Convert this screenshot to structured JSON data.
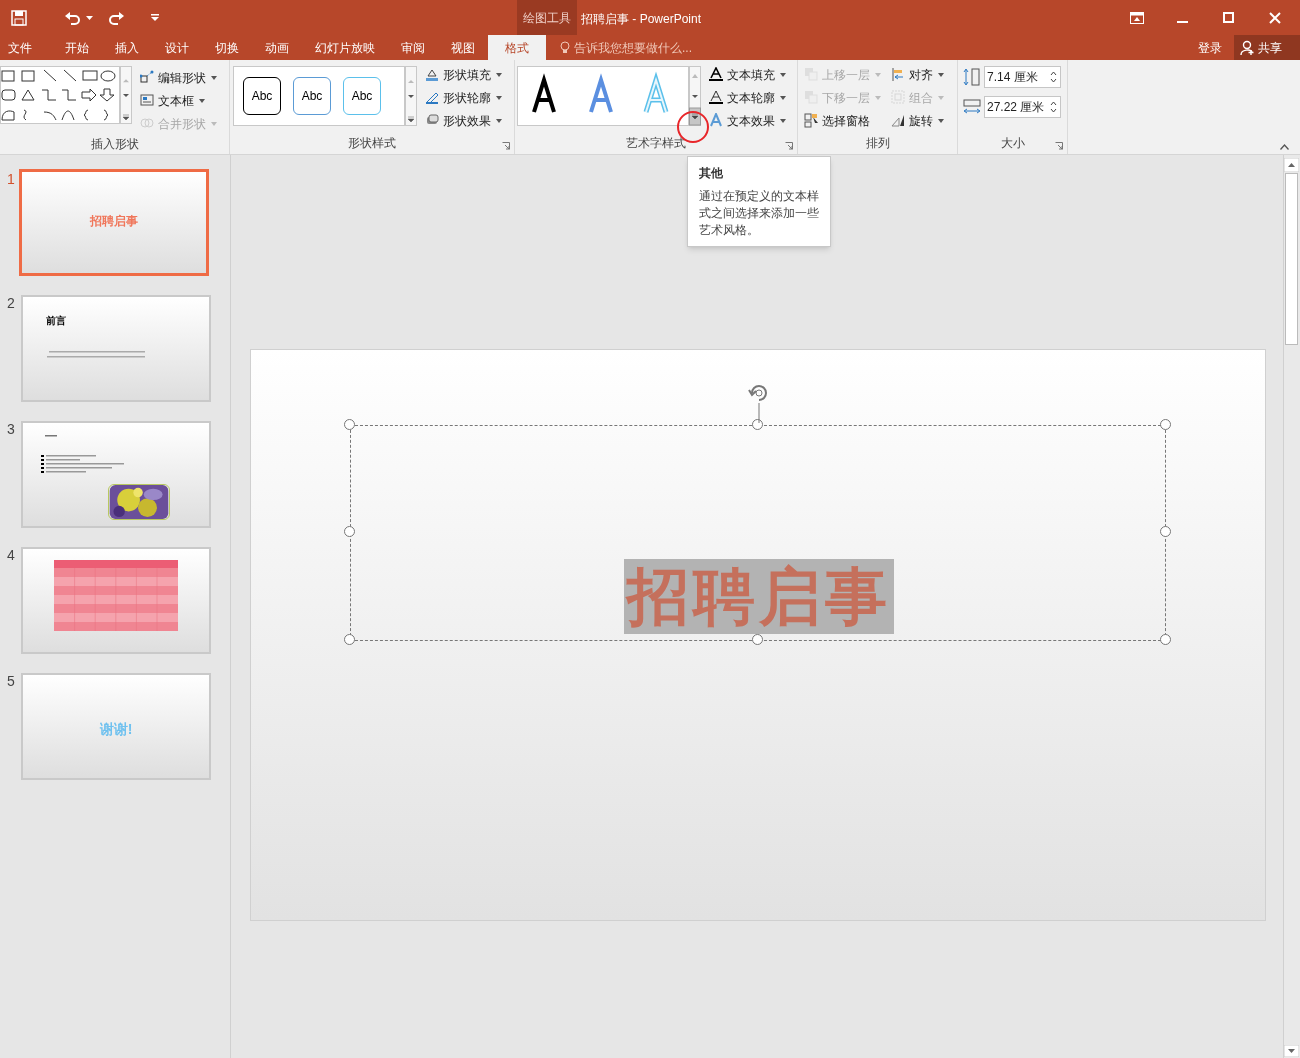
{
  "window": {
    "context_tab": "绘图工具",
    "title": "招聘启事 - PowerPoint"
  },
  "tabs": [
    {
      "label": "文件",
      "selected": false
    },
    {
      "label": "开始",
      "selected": false
    },
    {
      "label": "插入",
      "selected": false
    },
    {
      "label": "设计",
      "selected": false
    },
    {
      "label": "切换",
      "selected": false
    },
    {
      "label": "动画",
      "selected": false
    },
    {
      "label": "幻灯片放映",
      "selected": false
    },
    {
      "label": "审阅",
      "selected": false
    },
    {
      "label": "视图",
      "selected": false
    },
    {
      "label": "格式",
      "selected": true
    }
  ],
  "tell_me": {
    "placeholder": "告诉我您想要做什么..."
  },
  "account": {
    "sign_in": "登录",
    "share": "共享"
  },
  "ribbon": {
    "insert_shapes": {
      "label": "插入形状",
      "buttons": [
        {
          "label": "编辑形状",
          "disabled": false,
          "dropdown": true
        },
        {
          "label": "文本框",
          "disabled": false,
          "dropdown": true
        },
        {
          "label": "合并形状",
          "disabled": true,
          "dropdown": true
        }
      ]
    },
    "shape_styles": {
      "label": "形状样式",
      "styles": [
        {
          "label": "Abc",
          "color": "#000000"
        },
        {
          "label": "Abc",
          "color": "#5b9bd5"
        },
        {
          "label": "Abc",
          "color": "#5bc0eb"
        }
      ],
      "buttons": [
        {
          "label": "形状填充",
          "disabled": false,
          "dropdown": true
        },
        {
          "label": "形状轮廓",
          "disabled": false,
          "dropdown": true
        },
        {
          "label": "形状效果",
          "disabled": false,
          "dropdown": true
        }
      ]
    },
    "wordart_styles": {
      "label": "艺术字样式",
      "buttons": [
        {
          "label": "文本填充",
          "disabled": false,
          "dropdown": true
        },
        {
          "label": "文本轮廓",
          "disabled": false,
          "dropdown": true
        },
        {
          "label": "文本效果",
          "disabled": false,
          "dropdown": true
        }
      ]
    },
    "arrange": {
      "label": "排列",
      "buttons": [
        {
          "label": "上移一层",
          "disabled": true,
          "dropdown": true
        },
        {
          "label": "下移一层",
          "disabled": true,
          "dropdown": true
        },
        {
          "label": "选择窗格",
          "disabled": false,
          "dropdown": false
        },
        {
          "label": "对齐",
          "disabled": false,
          "dropdown": true
        },
        {
          "label": "组合",
          "disabled": true,
          "dropdown": true
        },
        {
          "label": "旋转",
          "disabled": false,
          "dropdown": true
        }
      ]
    },
    "size": {
      "label": "大小",
      "height": "7.14 厘米",
      "width": "27.22 厘米"
    }
  },
  "tooltip": {
    "title": "其他",
    "text": "通过在预定义的文本样式之间选择来添加一些艺术风格。"
  },
  "slides": [
    {
      "number": "1",
      "selected": true,
      "kind": "title",
      "title": "招聘启事"
    },
    {
      "number": "2",
      "selected": false,
      "kind": "text",
      "title": "前言"
    },
    {
      "number": "3",
      "selected": false,
      "kind": "list"
    },
    {
      "number": "4",
      "selected": false,
      "kind": "table"
    },
    {
      "number": "5",
      "selected": false,
      "kind": "thanks",
      "title": "谢谢!"
    }
  ],
  "slide": {
    "title": "招聘启事"
  }
}
